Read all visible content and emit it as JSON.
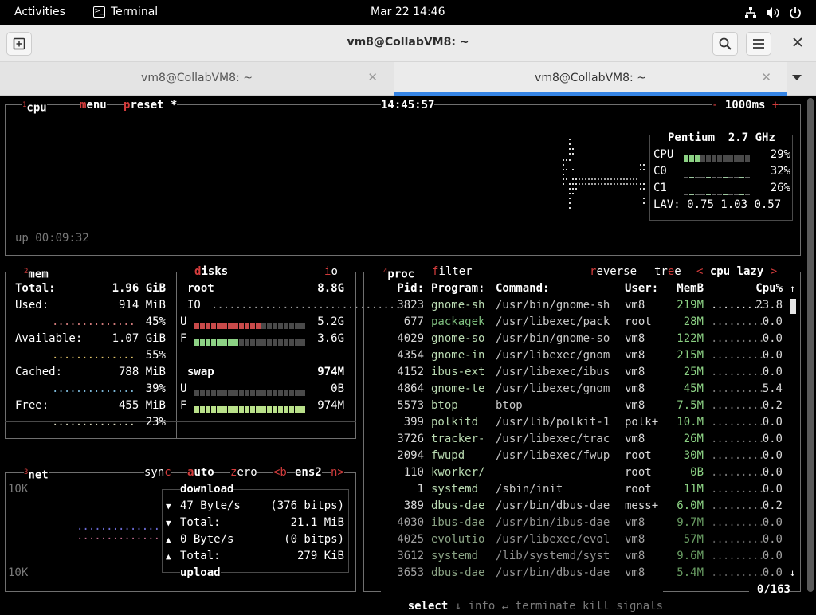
{
  "topbar": {
    "activities": "Activities",
    "app": "Terminal",
    "clock": "Mar 22  14:46"
  },
  "window": {
    "title": "vm8@CollabVM8: ~"
  },
  "tabs": [
    {
      "label": "vm8@CollabVM8: ~"
    },
    {
      "label": "vm8@CollabVM8: ~"
    }
  ],
  "cpu": {
    "num": "1",
    "title": "cpu",
    "menu": "menu",
    "preset": "preset *",
    "time": "14:45:57",
    "interval": "1000ms",
    "uptime": "up 00:09:32",
    "model": "Pentium",
    "freq": "2.7 GHz",
    "rows": [
      {
        "label": "CPU",
        "pct": "29%",
        "fill": 0.29
      },
      {
        "label": "C0",
        "pct": "32%",
        "fill": 0.32
      },
      {
        "label": "C1",
        "pct": "26%",
        "fill": 0.26
      }
    ],
    "lav_label": "LAV:",
    "lav": "0.75 1.03 0.57"
  },
  "mem": {
    "num": "2",
    "title": "mem",
    "total_label": "Total:",
    "total": "1.96 GiB",
    "items": [
      {
        "label": "Used:",
        "value": "914 MiB",
        "pct": "45%"
      },
      {
        "label": "Available:",
        "value": "1.07 GiB",
        "pct": "55%"
      },
      {
        "label": "Cached:",
        "value": "788 MiB",
        "pct": "39%"
      },
      {
        "label": "Free:",
        "value": "455 MiB",
        "pct": "23%"
      }
    ]
  },
  "disks": {
    "title": "disks",
    "io_tag": "io",
    "root_label": "root",
    "root_size": "8.8G",
    "io_label": "IO",
    "u_label": "U",
    "u_value": "5.2G",
    "u_fill": 0.59,
    "f_label": "F",
    "f_value": "3.6G",
    "f_fill": 0.41,
    "swap_label": "swap",
    "swap_size": "974M",
    "su_value": "0B",
    "su_fill": 0,
    "sf_value": "974M",
    "sf_fill": 1
  },
  "net": {
    "num": "3",
    "title": "net",
    "sync": "sync",
    "auto": "auto",
    "zero": "zero",
    "prev": "<b",
    "iface": "ens2",
    "next": "n>",
    "scale_top": "10K",
    "scale_bottom": "10K",
    "download": "download",
    "upload": "upload",
    "rows": [
      {
        "arrow": "▼",
        "label": "47 Byte/s",
        "value": "(376 bitps)"
      },
      {
        "arrow": "▼",
        "label": "Total:",
        "value": "21.1 MiB"
      },
      {
        "arrow": "▲",
        "label": "0 Byte/s",
        "value": "(0 bitps)"
      },
      {
        "arrow": "▲",
        "label": "Total:",
        "value": "279 KiB"
      }
    ]
  },
  "proc": {
    "num": "4",
    "title": "proc",
    "filter": "filter",
    "reverse": "reverse",
    "tree": "tree",
    "sort": "cpu lazy",
    "headers": {
      "pid": "Pid:",
      "program": "Program:",
      "command": "Command:",
      "user": "User:",
      "memb": "MemB",
      "cpu": "Cpu%"
    },
    "rows": [
      {
        "pid": "3823",
        "program": "gnome-sh",
        "command": "/usr/bin/gnome-sh",
        "user": "vm8",
        "mem": "219M",
        "cpu": "23.8"
      },
      {
        "pid": "677",
        "program": "packagek",
        "command": "/usr/libexec/pack",
        "user": "root",
        "mem": "28M",
        "cpu": "0.0"
      },
      {
        "pid": "4029",
        "program": "gnome-so",
        "command": "/usr/bin/gnome-so",
        "user": "vm8",
        "mem": "122M",
        "cpu": "0.0"
      },
      {
        "pid": "4354",
        "program": "gnome-in",
        "command": "/usr/libexec/gnom",
        "user": "vm8",
        "mem": "215M",
        "cpu": "0.0"
      },
      {
        "pid": "4152",
        "program": "ibus-ext",
        "command": "/usr/libexec/ibus",
        "user": "vm8",
        "mem": "25M",
        "cpu": "0.0"
      },
      {
        "pid": "4864",
        "program": "gnome-te",
        "command": "/usr/libexec/gnom",
        "user": "vm8",
        "mem": "45M",
        "cpu": "5.4"
      },
      {
        "pid": "5573",
        "program": "btop",
        "command": "btop",
        "user": "vm8",
        "mem": "7.5M",
        "cpu": "0.2"
      },
      {
        "pid": "399",
        "program": "polkitd",
        "command": "/usr/lib/polkit-1",
        "user": "polk+",
        "mem": "10.M",
        "cpu": "0.0"
      },
      {
        "pid": "3726",
        "program": "tracker-",
        "command": "/usr/libexec/trac",
        "user": "vm8",
        "mem": "26M",
        "cpu": "0.0"
      },
      {
        "pid": "2094",
        "program": "fwupd",
        "command": "/usr/libexec/fwup",
        "user": "root",
        "mem": "30M",
        "cpu": "0.0"
      },
      {
        "pid": "110",
        "program": "kworker/",
        "command": "",
        "user": "root",
        "mem": "0B",
        "cpu": "0.0"
      },
      {
        "pid": "1",
        "program": "systemd",
        "command": "/sbin/init",
        "user": "root",
        "mem": "11M",
        "cpu": "0.0"
      },
      {
        "pid": "389",
        "program": "dbus-dae",
        "command": "/usr/bin/dbus-dae",
        "user": "mess+",
        "mem": "6.0M",
        "cpu": "0.2"
      },
      {
        "pid": "4030",
        "program": "ibus-dae",
        "command": "/usr/bin/ibus-dae",
        "user": "vm8",
        "mem": "9.7M",
        "cpu": "0.0"
      },
      {
        "pid": "4025",
        "program": "evolutio",
        "command": "/usr/libexec/evol",
        "user": "vm8",
        "mem": "57M",
        "cpu": "0.0"
      },
      {
        "pid": "3612",
        "program": "systemd",
        "command": "/lib/systemd/syst",
        "user": "vm8",
        "mem": "9.6M",
        "cpu": "0.0"
      },
      {
        "pid": "3653",
        "program": "dbus-dae",
        "command": "/usr/bin/dbus-dae",
        "user": "vm8",
        "mem": "5.4M",
        "cpu": "0.0"
      }
    ],
    "footer": {
      "select": "select",
      "info": "info",
      "terminate": "terminate",
      "kill": "kill",
      "signals": "signals",
      "count": "0/163"
    }
  },
  "colors": {
    "accent": "#d23c3c",
    "graph_green": "#8cd184",
    "used_red": "#c94a4a",
    "tab_active": "#3584e4"
  }
}
